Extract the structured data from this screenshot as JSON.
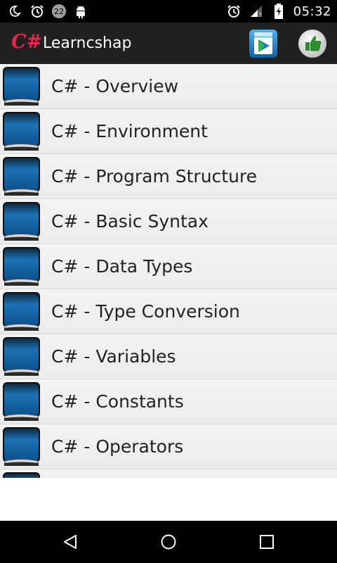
{
  "status_bar": {
    "time": "05:32",
    "notification_count": "22",
    "icons_left": [
      "moon-crescent-icon",
      "alarm-icon",
      "badge-22",
      "android-icon"
    ],
    "icons_right": [
      "alarm-icon",
      "signal-icon",
      "battery-charging-icon"
    ]
  },
  "app_bar": {
    "logo": "C#",
    "title": "Learncshap",
    "accent_color": "#e8274f"
  },
  "list": {
    "items": [
      {
        "label": "C# - Overview"
      },
      {
        "label": "C# - Environment"
      },
      {
        "label": "C# - Program Structure"
      },
      {
        "label": "C# - Basic Syntax"
      },
      {
        "label": "C# - Data Types"
      },
      {
        "label": "C# - Type Conversion"
      },
      {
        "label": "C# - Variables"
      },
      {
        "label": "C# - Constants"
      },
      {
        "label": "C# - Operators"
      }
    ]
  },
  "colors": {
    "status_bar": "#000000",
    "app_bar": "#202020",
    "book_blue": "#1f7fc0",
    "row_bg": "#efefef",
    "nav_bar": "#000000"
  }
}
